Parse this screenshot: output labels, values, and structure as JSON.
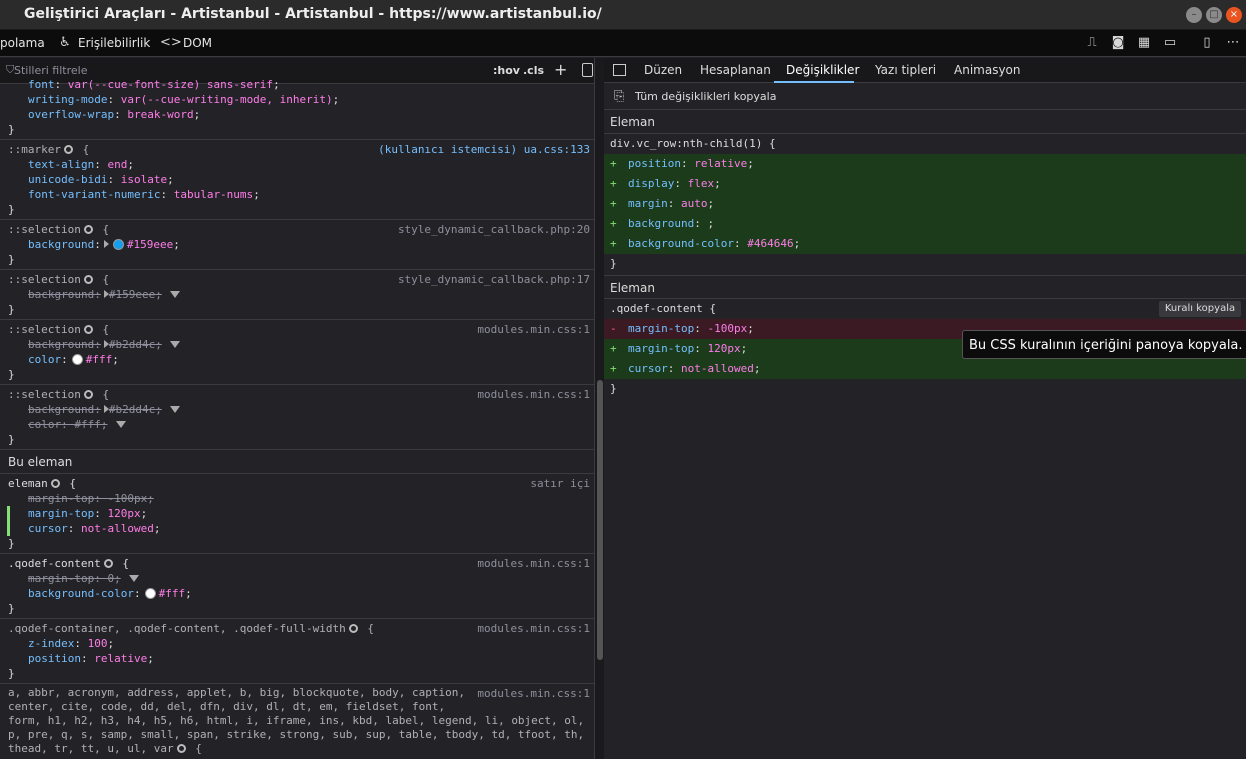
{
  "window": {
    "title": "Geliştirici Araçları - Artistanbul - Artistanbul - https://www.artistanbul.io/"
  },
  "toolbar": {
    "tabs": [
      "polama",
      "Erişilebilirlik",
      "DOM"
    ],
    "icons": [
      "responsive-icon",
      "screenshot-icon",
      "rulers-icon",
      "measure-icon",
      "dock-icon",
      "more-icon"
    ]
  },
  "styles": {
    "filter_placeholder": "Stilleri filtrele",
    "hov": ":hov",
    "cls": ".cls",
    "rules": [
      {
        "selector": "",
        "source": "",
        "decls": [
          {
            "prop": "font",
            "value": "var(--cue-font-size) sans-serif",
            "struck": false
          },
          {
            "prop": "writing-mode",
            "value": "var(--cue-writing-mode, inherit)",
            "struck": false
          },
          {
            "prop": "overflow-wrap",
            "value": "break-word",
            "struck": false
          }
        ]
      },
      {
        "selector": "::marker",
        "source": "(kullanıcı istemcisi) ua.css:133",
        "decls": [
          {
            "prop": "text-align",
            "value": "end",
            "struck": false
          },
          {
            "prop": "unicode-bidi",
            "value": "isolate",
            "struck": false
          },
          {
            "prop": "font-variant-numeric",
            "value": "tabular-nums",
            "struck": false
          }
        ]
      },
      {
        "selector": "::selection",
        "source": "style_dynamic_callback.php:20",
        "decls": [
          {
            "prop": "background",
            "value": "#159eee",
            "struck": false,
            "color": "#159eee"
          }
        ]
      },
      {
        "selector": "::selection",
        "source": "style_dynamic_callback.php:17",
        "decls": [
          {
            "prop": "background",
            "value": "#159eee",
            "struck": true
          }
        ]
      },
      {
        "selector": "::selection",
        "source": "modules.min.css:1",
        "decls": [
          {
            "prop": "background",
            "value": "#b2dd4c",
            "struck": true
          },
          {
            "prop": "color",
            "value": "#fff",
            "struck": false,
            "color": "#ffffff"
          }
        ]
      },
      {
        "selector": "::selection",
        "source": "modules.min.css:1",
        "decls": [
          {
            "prop": "background",
            "value": "#b2dd4c",
            "struck": true
          },
          {
            "prop": "color",
            "value": "#fff",
            "struck": true
          }
        ]
      }
    ],
    "element_section": "Bu eleman",
    "element_rules": [
      {
        "selector": "eleman",
        "source": "satır içi",
        "decls": [
          {
            "prop": "margin-top",
            "value": "-100px",
            "struck": true
          },
          {
            "prop": "margin-top",
            "value": "120px",
            "struck": false
          },
          {
            "prop": "cursor",
            "value": "not-allowed",
            "struck": false
          }
        ]
      },
      {
        "selector": ".qodef-content",
        "source": "modules.min.css:1",
        "decls": [
          {
            "prop": "margin-top",
            "value": "0",
            "struck": true
          },
          {
            "prop": "background-color",
            "value": "#fff",
            "struck": false,
            "color": "#ffffff"
          }
        ]
      },
      {
        "selector": ".qodef-container, .qodef-content, .qodef-full-width",
        "source": "modules.min.css:1",
        "decls": [
          {
            "prop": "z-index",
            "value": "100",
            "struck": false
          },
          {
            "prop": "position",
            "value": "relative",
            "struck": false
          }
        ]
      }
    ],
    "long_selector": [
      "a, abbr, acronym, address, applet, b, big, blockquote, body, caption,",
      "center, cite, code, dd, del, dfn, div, dl, dt, em, fieldset, font,",
      "form, h1, h2, h3, h4, h5, h6, html, i, iframe, ins, kbd, label, legend, li, object, ol,",
      "p, pre, q, s, samp, small, span, strike, strong, sub, sup, table, tbody, td, tfoot, th,",
      "thead, tr, tt, u, ul, var"
    ],
    "long_selector_source": "modules.min.css:1"
  },
  "sidebar": {
    "tabs": [
      "Düzen",
      "Hesaplanan",
      "Değişiklikler",
      "Yazı tipleri",
      "Animasyon"
    ],
    "active_tab": "Değişiklikler",
    "copy_all": "Tüm değişiklikleri kopyala",
    "changes": [
      {
        "section": "Eleman",
        "selector": "div.vc_row:nth-child(1) {",
        "lines": [
          {
            "sign": "+",
            "prop": "position",
            "value": "relative"
          },
          {
            "sign": "+",
            "prop": "display",
            "value": "flex"
          },
          {
            "sign": "+",
            "prop": "margin",
            "value": "auto"
          },
          {
            "sign": "+",
            "prop": "background",
            "value": ""
          },
          {
            "sign": "+",
            "prop": "background-color",
            "value": "#464646"
          }
        ]
      },
      {
        "section": "Eleman",
        "selector": ".qodef-content {",
        "lines": [
          {
            "sign": "-",
            "prop": "margin-top",
            "value": "-100px"
          },
          {
            "sign": "+",
            "prop": "margin-top",
            "value": "120px"
          },
          {
            "sign": "+",
            "prop": "cursor",
            "value": "not-allowed"
          }
        ]
      }
    ],
    "copy_rule": "Kuralı kopyala",
    "tooltip": "Bu CSS kuralının içeriğini panoya kopyala."
  }
}
